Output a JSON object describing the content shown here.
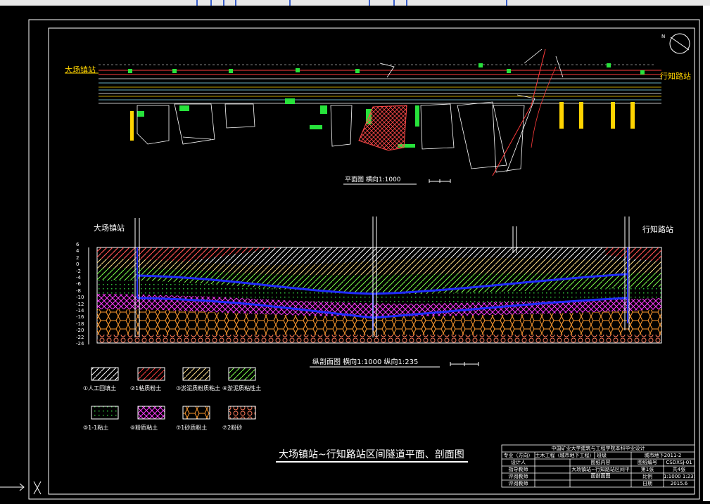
{
  "plan": {
    "station_left": "大场镇站",
    "station_right": "行知路站",
    "caption": "平面图  横向1:1000"
  },
  "profile": {
    "station_left": "大场镇站",
    "station_right": "行知路站",
    "caption": "纵剖面图  横向1:1000 纵向1:235",
    "y_ticks": [
      "6",
      "4",
      "2",
      "0",
      "-2",
      "-4",
      "-6",
      "-8",
      "-10",
      "-12",
      "-14",
      "-16",
      "-18",
      "-20",
      "-22",
      "-24"
    ]
  },
  "legend": [
    {
      "label": "①人工回填土",
      "color": "#ffffff"
    },
    {
      "label": "②1粘质粉土",
      "color": "#ff3b3b"
    },
    {
      "label": "③淤泥质粉质粘土",
      "color": "#ffe08a"
    },
    {
      "label": "④淤泥质粘性土",
      "color": "#7dff4a"
    },
    {
      "label": "⑤1-1粘土",
      "color": "#2fbf3a"
    },
    {
      "label": "⑥粉质粘土",
      "color": "#ff3bff"
    },
    {
      "label": "⑦1砂质粉土",
      "color": "#ff9a2e"
    },
    {
      "label": "⑦2粉砂",
      "color": "#ff7a5a"
    }
  ],
  "drawing_title": "大场镇站~行知路站区间隧道平面、剖面图",
  "title_block": {
    "university": "中国矿业大学建筑与工程学院本科毕业设计",
    "major_label": "专业（方向）",
    "major": "土木工程（城市地下工程）",
    "class_label": "班级",
    "class": "城市地下2011-2",
    "designer": "设计人",
    "content_label": "图纸内容",
    "drawing_no_label": "图纸编号",
    "drawing_no": "CSDXSJ-01",
    "advisor1": "指导教师",
    "contents": "大场镇站~行知路站区间平面剖面图",
    "sheet": "第1张",
    "total": "共4张",
    "reviewer1": "评阅教师",
    "scale_label": "比例",
    "scale": "1:1000 1:235",
    "reviewer2": "评阅教师",
    "date_label": "日期",
    "date": "2015.6"
  }
}
